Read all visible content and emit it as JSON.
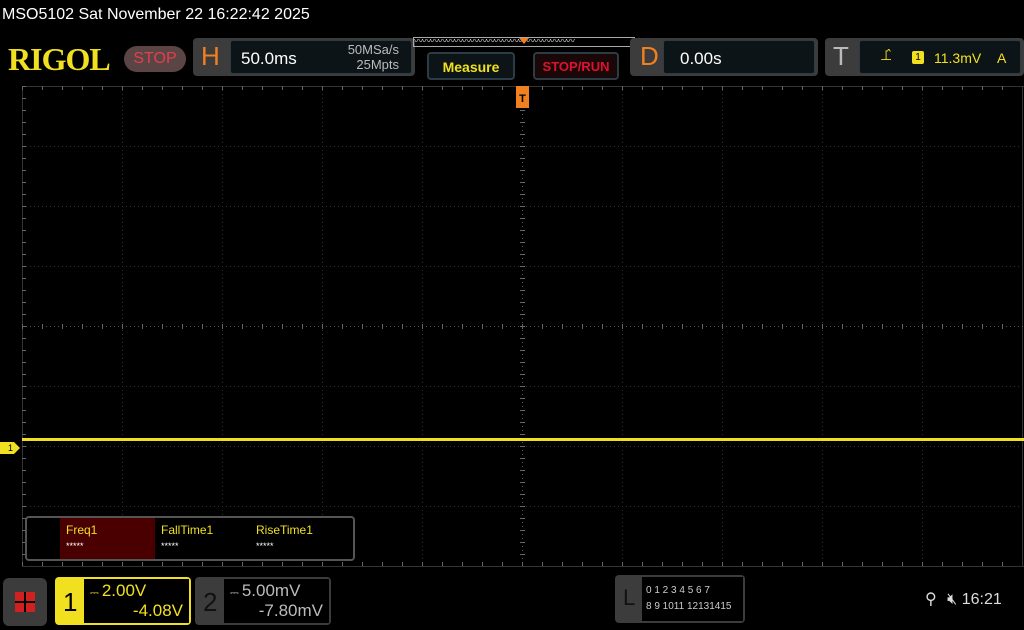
{
  "header": {
    "title": "MSO5102  Sat November 22 16:22:42 2025",
    "logo": "RIGOL",
    "run_state": "STOP"
  },
  "horizontal": {
    "letter": "H",
    "timebase": "50.0ms",
    "sample_rate": "50MSa/s",
    "memory_depth": "25Mpts"
  },
  "buttons": {
    "measure": "Measure",
    "stop_run": "STOP/RUN"
  },
  "delay": {
    "letter": "D",
    "value": "0.00s"
  },
  "trigger": {
    "letter": "T",
    "slope_icon": "rising-edge-icon",
    "source": "1",
    "level": "11.3mV",
    "mode": "A",
    "marker": "T"
  },
  "channel_marker": "1",
  "measurements": [
    {
      "label": "Freq1",
      "value": "*****"
    },
    {
      "label": "FallTime1",
      "value": "*****"
    },
    {
      "label": "RiseTime1",
      "value": "*****"
    }
  ],
  "channels": [
    {
      "number": "1",
      "coupling_icon": "dc-coupling-icon",
      "scale": "2.00V",
      "offset": "-4.08V",
      "color": "#f0e020",
      "active": true
    },
    {
      "number": "2",
      "coupling_icon": "dc-coupling-icon",
      "scale": "5.00mV",
      "offset": "-7.80mV",
      "color": "#bbbbbb",
      "active": false
    }
  ],
  "logic": {
    "letter": "L",
    "row1": "0 1 2 3  4 5 6 7",
    "row2": "8 9 1011 12131415"
  },
  "status": {
    "usb_icon": "usb-icon",
    "mute_icon": "speaker-muted-icon",
    "time": "16:21"
  },
  "colors": {
    "ch1": "#f0e020",
    "accent": "#f08020",
    "stop": "#e04050"
  }
}
